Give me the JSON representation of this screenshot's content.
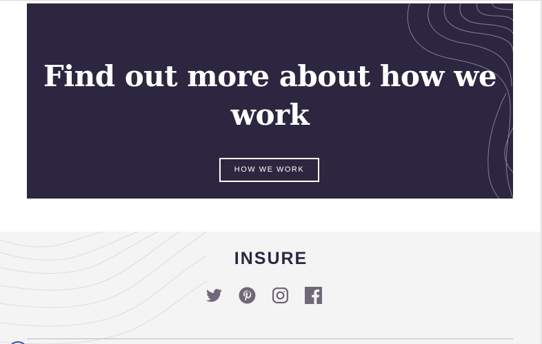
{
  "cta": {
    "heading_line1": "Find out more about how we",
    "heading_line2": "work",
    "button_label": "HOW WE WORK"
  },
  "footer": {
    "logo": "INSURE",
    "socials": [
      {
        "icon": "twitter-icon"
      },
      {
        "icon": "pinterest-icon"
      },
      {
        "icon": "instagram-icon"
      },
      {
        "icon": "facebook-icon"
      }
    ]
  },
  "colors": {
    "cta_background": "#2c2640",
    "footer_background": "#f4f4f4",
    "icon_color": "#6f6878",
    "text_white": "#ffffff",
    "logo_color": "#2c2640"
  }
}
